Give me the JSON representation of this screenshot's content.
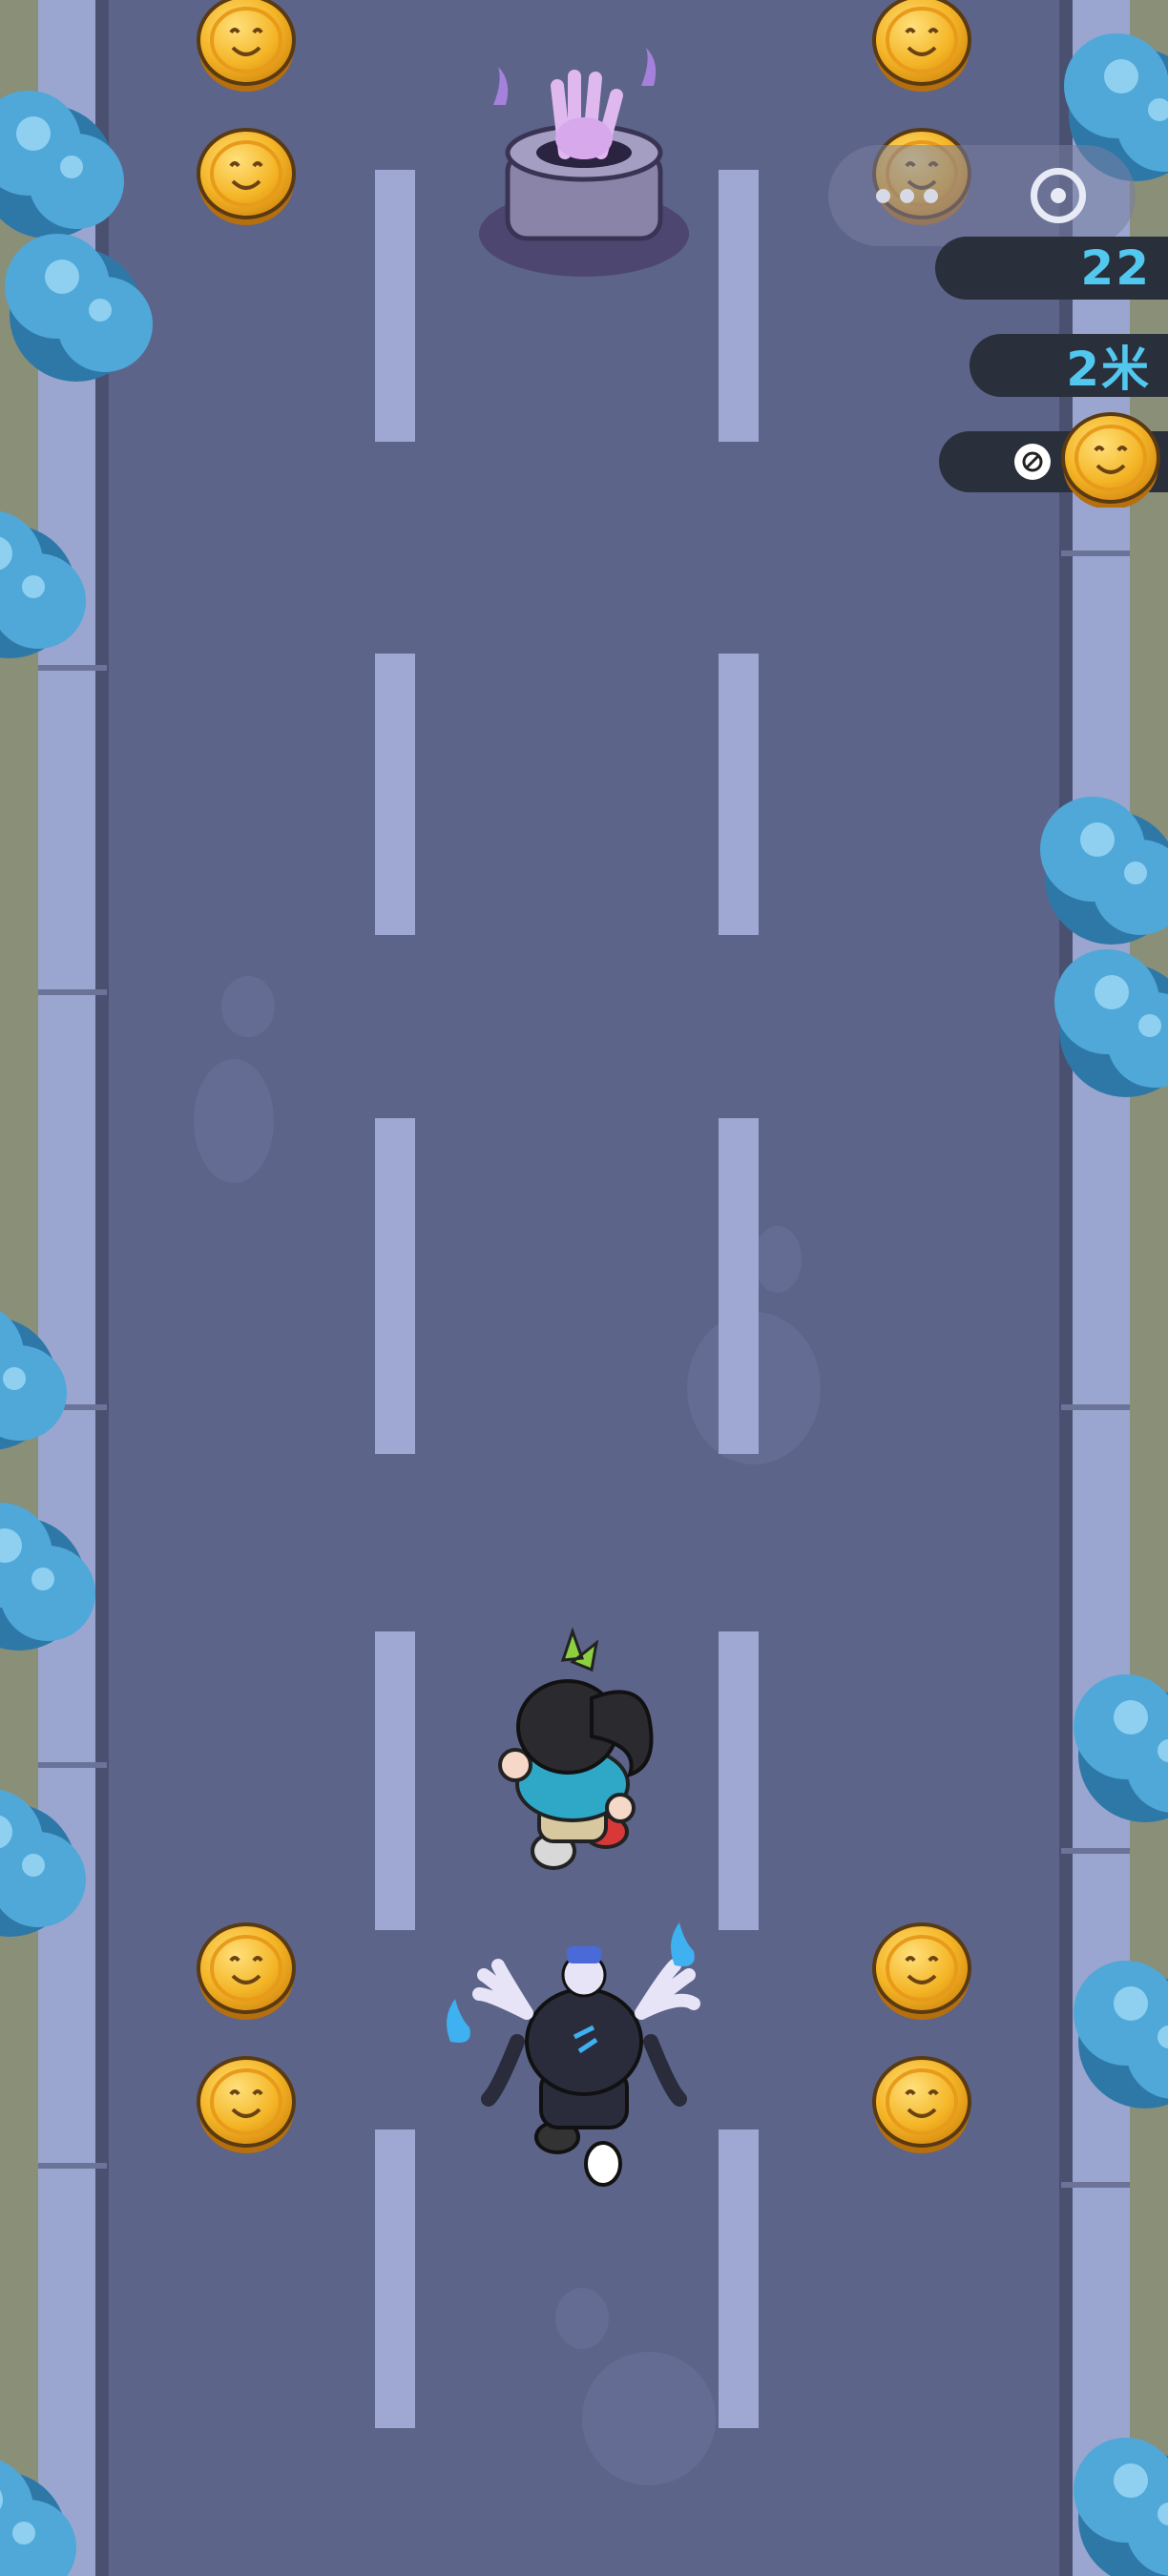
{
  "hud": {
    "score": "22",
    "distance": "2米",
    "coin_count": ""
  },
  "colors": {
    "road": "#5c6489",
    "lane_mark": "#9ea8d2",
    "curb": "#9aa6cf",
    "tree": "#4fa8d8",
    "coin_gold": "#f4b526",
    "hud_text": "#52c8ef",
    "hud_bg": "#2a2f3c"
  },
  "icons": {
    "capsule_more": "more-dots-icon",
    "capsule_close": "target-circle-icon",
    "coin": "coin-icon"
  }
}
